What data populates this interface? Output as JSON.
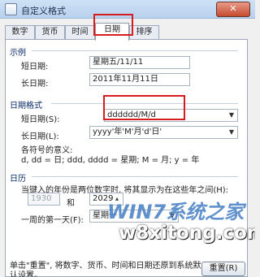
{
  "window": {
    "title": "自定义格式",
    "close_label": "✕"
  },
  "tabs": [
    {
      "label": "数字"
    },
    {
      "label": "货币"
    },
    {
      "label": "时间"
    },
    {
      "label": "日期",
      "active": true
    },
    {
      "label": "排序"
    }
  ],
  "example": {
    "heading": "示例",
    "short_label": "短日期:",
    "short_value": "星期五/11/11",
    "long_label": "长日期:",
    "long_value": "2011年11月11日"
  },
  "date_formats": {
    "heading": "日期格式",
    "short_label": "短日期(S):",
    "short_value": "dddddd/M/d",
    "long_label": "长日期(L):",
    "long_value": "yyyy'年'M'月'd'日'",
    "legend_title": "各符号的意义:",
    "legend_text": "d, dd = 日;  ddd, dddd = 星期;  M = 月;  y = 年"
  },
  "calendar": {
    "heading": "日历",
    "two_digit_text": "当键入的年份是两位数字时, 将其显示为在这些年之间(H):",
    "start_year": "1930",
    "and_label": "和",
    "end_year": "2029",
    "first_day_label": "一周的第一天(F):",
    "first_day_value": "星期一"
  },
  "footer": {
    "note": "单击\"重置\", 将数字、货币、时间和日期还原到系统默认设置。",
    "reset_label": "重置(R)"
  },
  "watermark": {
    "logo": "WIN7系统之家",
    "site": "w8xitong.com"
  },
  "colors": {
    "highlight_red": "#d61c1c",
    "group_heading": "#0a2a6b"
  }
}
